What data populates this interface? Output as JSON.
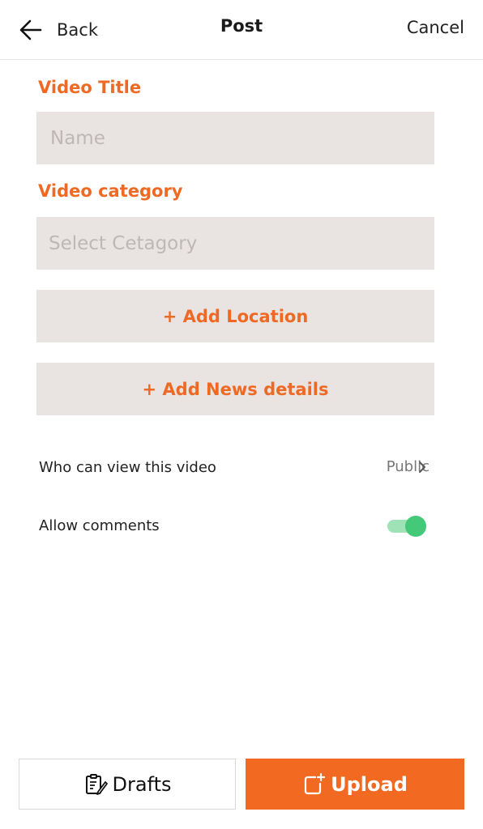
{
  "header": {
    "back_label": "Back",
    "title": "Post",
    "cancel_label": "Cancel"
  },
  "form": {
    "title_label": "Video Title",
    "title_placeholder": "Name",
    "category_label": "Video category",
    "category_placeholder": "Select Cetagory",
    "add_location_label": "+ Add Location",
    "add_news_label": "+ Add News details"
  },
  "settings": {
    "privacy_label": "Who can view this video",
    "privacy_value": "Public",
    "comments_label": "Allow comments",
    "comments_enabled": true
  },
  "footer": {
    "drafts_label": "Drafts",
    "upload_label": "Upload"
  },
  "colors": {
    "accent": "#f26a22",
    "toggle_on": "#43c978",
    "field_bg": "#e9e3e2"
  },
  "icons": [
    "back-arrow-icon",
    "chevron-right-icon",
    "drafts-icon",
    "upload-icon"
  ]
}
